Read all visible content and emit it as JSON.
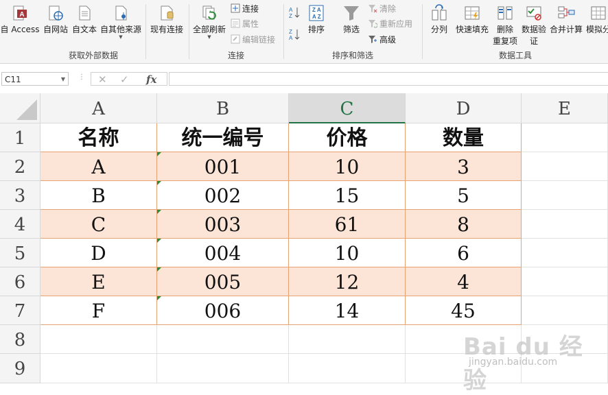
{
  "ribbon": {
    "get_external": {
      "label": "获取外部数据",
      "items": [
        "自 Access",
        "自网站",
        "自文本",
        "自其他来源",
        "现有连接"
      ]
    },
    "connections": {
      "label": "连接",
      "refresh_all": "全部刷新",
      "connections": "连接",
      "properties": "属性",
      "edit_links": "编辑链接"
    },
    "sort_filter": {
      "label": "排序和筛选",
      "sort": "排序",
      "filter": "筛选",
      "clear": "清除",
      "reapply": "重新应用",
      "advanced": "高级"
    },
    "data_tools": {
      "label": "数据工具",
      "split": "分列",
      "flash_fill": "快速填充",
      "remove_dup_1": "删除",
      "remove_dup_2": "重复项",
      "validation_1": "数据验",
      "validation_2": "证",
      "consolidate": "合并计算",
      "whatif": "模拟分"
    }
  },
  "formula_bar": {
    "name_box": "C11",
    "fx": "fx",
    "formula": ""
  },
  "sheet": {
    "columns": [
      "A",
      "B",
      "C",
      "D",
      "E"
    ],
    "rows": [
      "1",
      "2",
      "3",
      "4",
      "5",
      "6",
      "7",
      "8",
      "9"
    ],
    "headers": [
      "名称",
      "统一编号",
      "价格",
      "数量"
    ],
    "data": [
      [
        "A",
        "001",
        "10",
        "3"
      ],
      [
        "B",
        "002",
        "15",
        "5"
      ],
      [
        "C",
        "003",
        "61",
        "8"
      ],
      [
        "D",
        "004",
        "10",
        "6"
      ],
      [
        "E",
        "005",
        "12",
        "4"
      ],
      [
        "F",
        "006",
        "14",
        "45"
      ]
    ]
  },
  "watermark": {
    "brand": "Bai du 经验",
    "url": "jingyan.baidu.com"
  }
}
